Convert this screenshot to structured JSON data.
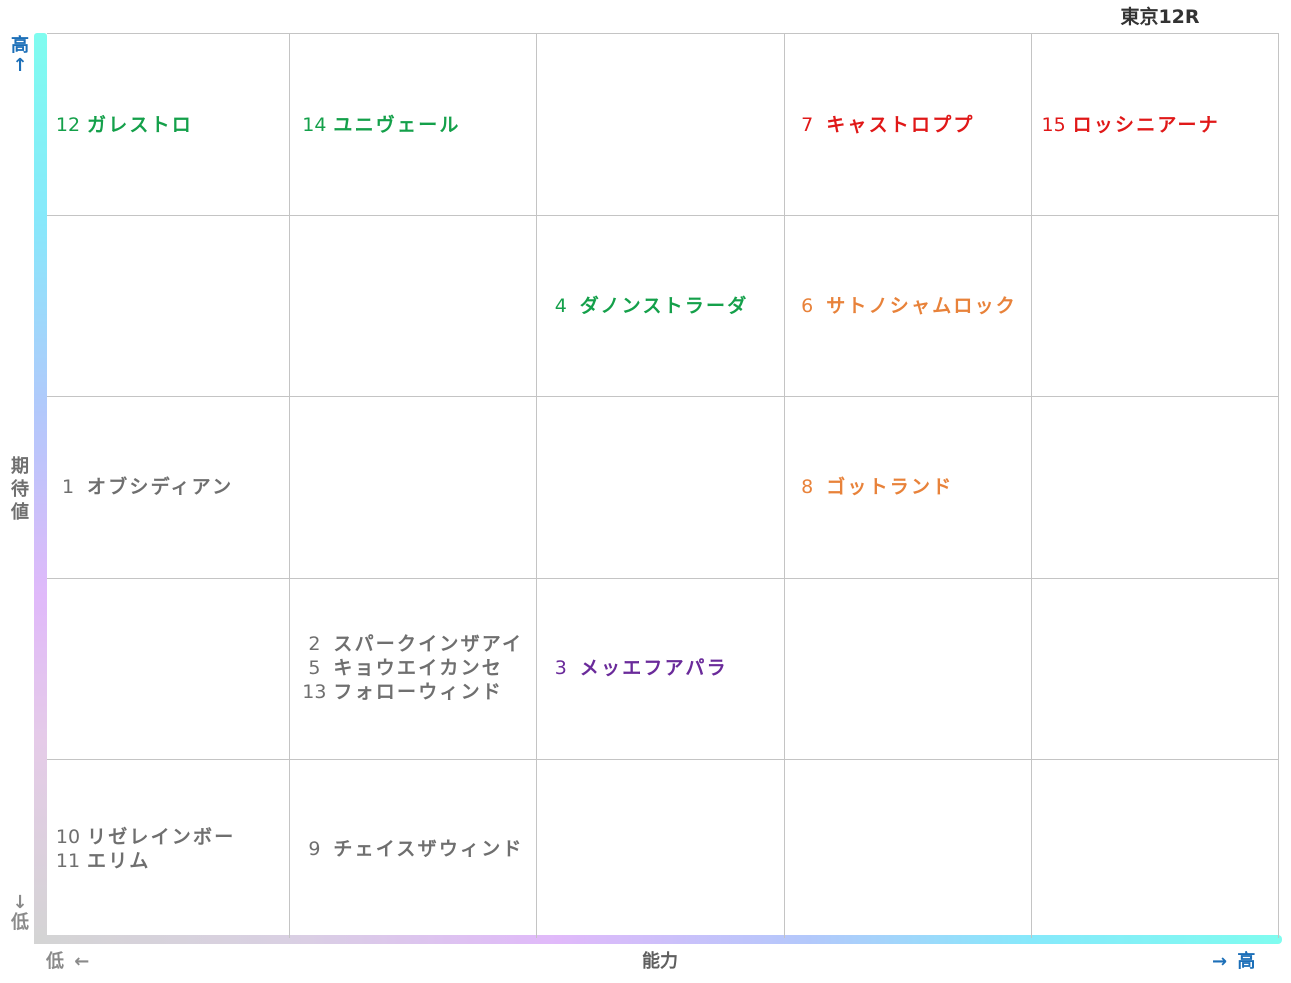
{
  "header": {
    "race": "東京12R"
  },
  "axes": {
    "y_high_label": "高",
    "y_high_arrow": "↑",
    "y_low_arrow": "↓",
    "y_low_label": "低",
    "y_title": [
      "期",
      "待",
      "値"
    ],
    "x_low_label": "低 ←",
    "x_title": "能力",
    "x_high_label": "→ 高"
  },
  "colors": {
    "green": "#14a04a",
    "red": "#e01818",
    "orange": "#e8823a",
    "purple": "#6a2a9a",
    "gray": "#6f6f6f"
  },
  "chart_data": {
    "type": "table",
    "title": "東京12R",
    "xlabel": "能力",
    "ylabel": "期待値",
    "columns": 5,
    "rows": 5,
    "cells": [
      {
        "row": 1,
        "col": 1,
        "color": "green",
        "entries": [
          {
            "num": "12",
            "name": "ガレストロ"
          }
        ]
      },
      {
        "row": 1,
        "col": 2,
        "color": "green",
        "entries": [
          {
            "num": "14",
            "name": "ユニヴェール"
          }
        ]
      },
      {
        "row": 1,
        "col": 4,
        "color": "red",
        "entries": [
          {
            "num": "7",
            "name": "キャストロププ"
          }
        ]
      },
      {
        "row": 1,
        "col": 5,
        "color": "red",
        "entries": [
          {
            "num": "15",
            "name": "ロッシニアーナ"
          }
        ]
      },
      {
        "row": 2,
        "col": 3,
        "color": "green",
        "entries": [
          {
            "num": "4",
            "name": "ダノンストラーダ"
          }
        ]
      },
      {
        "row": 2,
        "col": 4,
        "color": "orange",
        "entries": [
          {
            "num": "6",
            "name": "サトノシャムロック"
          }
        ]
      },
      {
        "row": 3,
        "col": 1,
        "color": "gray",
        "entries": [
          {
            "num": "1",
            "name": "オブシディアン"
          }
        ]
      },
      {
        "row": 3,
        "col": 4,
        "color": "orange",
        "entries": [
          {
            "num": "8",
            "name": "ゴットランド"
          }
        ]
      },
      {
        "row": 4,
        "col": 2,
        "color": "gray",
        "entries": [
          {
            "num": "2",
            "name": "スパークインザアイ"
          },
          {
            "num": "5",
            "name": "キョウエイカンセ"
          },
          {
            "num": "13",
            "name": "フォローウィンド"
          }
        ]
      },
      {
        "row": 4,
        "col": 3,
        "color": "purple",
        "entries": [
          {
            "num": "3",
            "name": "メッエフアパラ"
          }
        ]
      },
      {
        "row": 5,
        "col": 1,
        "color": "gray",
        "entries": [
          {
            "num": "10",
            "name": "リゼレインボー"
          },
          {
            "num": "11",
            "name": "エリム"
          }
        ]
      },
      {
        "row": 5,
        "col": 2,
        "color": "gray",
        "entries": [
          {
            "num": "9",
            "name": "チェイスザウィンド"
          }
        ]
      }
    ]
  }
}
